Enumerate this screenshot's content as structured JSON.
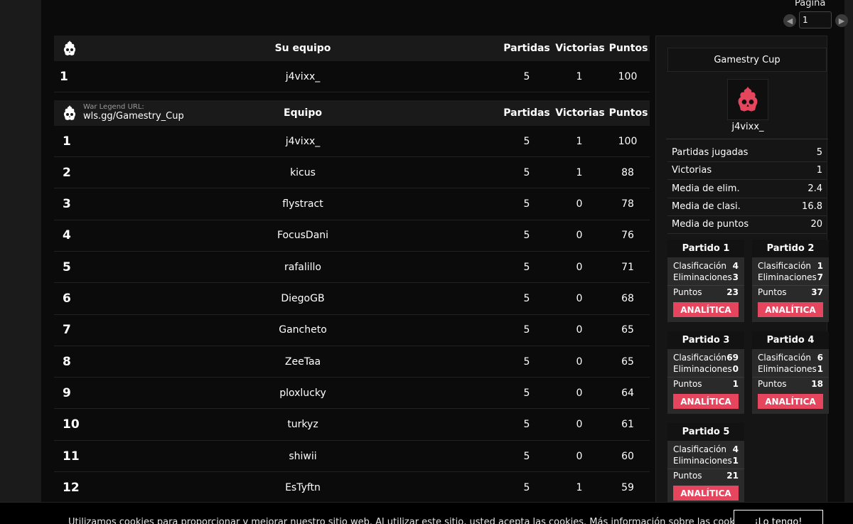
{
  "pager": {
    "label": "Página",
    "value": "1"
  },
  "own_team": {
    "headers": {
      "team": "Su equipo",
      "played": "Partidas",
      "wins": "Victorias",
      "points": "Puntos"
    },
    "row": {
      "rank": "1",
      "team": "j4vixx_",
      "played": "5",
      "wins": "1",
      "points": "100"
    }
  },
  "leaderboard": {
    "url_label": "War Legend URL:",
    "url_value": "wls.gg/Gamestry_Cup",
    "headers": {
      "team": "Equipo",
      "played": "Partidas",
      "wins": "Victorias",
      "points": "Puntos"
    },
    "rows": [
      {
        "rank": "1",
        "team": "j4vixx_",
        "played": "5",
        "wins": "1",
        "points": "100"
      },
      {
        "rank": "2",
        "team": "kicus",
        "played": "5",
        "wins": "1",
        "points": "88"
      },
      {
        "rank": "3",
        "team": "flystract",
        "played": "5",
        "wins": "0",
        "points": "78"
      },
      {
        "rank": "4",
        "team": "FocusDani",
        "played": "5",
        "wins": "0",
        "points": "76"
      },
      {
        "rank": "5",
        "team": "rafalillo",
        "played": "5",
        "wins": "0",
        "points": "71"
      },
      {
        "rank": "6",
        "team": "DiegoGB",
        "played": "5",
        "wins": "0",
        "points": "68"
      },
      {
        "rank": "7",
        "team": "Gancheto",
        "played": "5",
        "wins": "0",
        "points": "65"
      },
      {
        "rank": "8",
        "team": "ZeeTaa",
        "played": "5",
        "wins": "0",
        "points": "65"
      },
      {
        "rank": "9",
        "team": "ploxlucky",
        "played": "5",
        "wins": "0",
        "points": "64"
      },
      {
        "rank": "10",
        "team": "turkyz",
        "played": "5",
        "wins": "0",
        "points": "61"
      },
      {
        "rank": "11",
        "team": "shiwii",
        "played": "5",
        "wins": "0",
        "points": "60"
      },
      {
        "rank": "12",
        "team": "EsTyftn",
        "played": "5",
        "wins": "1",
        "points": "59"
      }
    ]
  },
  "panel": {
    "cup_title": "Gamestry Cup",
    "team_name": "j4vixx_",
    "stats": [
      {
        "label": "Partidas jugadas",
        "value": "5"
      },
      {
        "label": "Victorias",
        "value": "1"
      },
      {
        "label": "Media de elim.",
        "value": "2.4"
      },
      {
        "label": "Media de clasi.",
        "value": "16.8"
      },
      {
        "label": "Media de puntos",
        "value": "20"
      }
    ],
    "matches": [
      {
        "title": "Partido 1",
        "class_label": "Clasificación",
        "class_value": "4",
        "elim_label": "Eliminaciones",
        "elim_value": "3",
        "pts_label": "Puntos",
        "pts_value": "23",
        "button": "ANALÍTICA"
      },
      {
        "title": "Partido 2",
        "class_label": "Clasificación",
        "class_value": "1",
        "elim_label": "Eliminaciones",
        "elim_value": "7",
        "pts_label": "Puntos",
        "pts_value": "37",
        "button": "ANALÍTICA"
      },
      {
        "title": "Partido 3",
        "class_label": "Clasificación",
        "class_value": "69",
        "elim_label": "Eliminaciones",
        "elim_value": "0",
        "pts_label": "Puntos",
        "pts_value": "1",
        "button": "ANALÍTICA"
      },
      {
        "title": "Partido 4",
        "class_label": "Clasificación",
        "class_value": "6",
        "elim_label": "Eliminaciones",
        "elim_value": "1",
        "pts_label": "Puntos",
        "pts_value": "18",
        "button": "ANALÍTICA"
      },
      {
        "title": "Partido 5",
        "class_label": "Clasificación",
        "class_value": "4",
        "elim_label": "Eliminaciones",
        "elim_value": "1",
        "pts_label": "Puntos",
        "pts_value": "21",
        "button": "ANALÍTICA"
      }
    ]
  },
  "cookie": {
    "text": "Utilizamos cookies para proporcionar y mejorar nuestro sitio web. Al utilizar este sitio, usted acepta las cookies. Más información sobre las cookies",
    "button": "¡Lo tengo!"
  },
  "colors": {
    "accent": "#e6455e",
    "background": "#0b0b0b",
    "header": "#1a1a1a"
  },
  "icons": {
    "logo": "skull-flame-icon",
    "prev": "chevron-left-icon",
    "next": "chevron-right-icon"
  }
}
